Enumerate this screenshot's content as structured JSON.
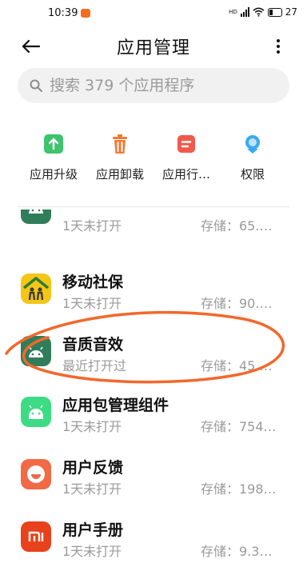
{
  "status_bar": {
    "time": "10:39",
    "network": "HD",
    "battery": "27"
  },
  "header": {
    "title": "应用管理"
  },
  "search": {
    "placeholder": "搜索 379 个应用程序"
  },
  "quick_actions": [
    {
      "label": "应用升级",
      "icon": "upgrade-icon",
      "color": "#3ec46d"
    },
    {
      "label": "应用卸载",
      "icon": "trash-icon",
      "color": "#f07a34"
    },
    {
      "label": "应用行…",
      "icon": "behavior-icon",
      "color": "#f2594b"
    },
    {
      "label": "权限",
      "icon": "permission-icon",
      "color": "#3aa9f0"
    }
  ],
  "apps": [
    {
      "name": "",
      "subtitle": "1天未打开",
      "size": "存储：65.…",
      "icon": "android-icon",
      "color": "#2f7d5b"
    },
    {
      "name": "移动社保",
      "subtitle": "1天未打开",
      "size": "存储：90.…",
      "icon": "family-house-icon",
      "color": "#f5c518"
    },
    {
      "name": "音质音效",
      "subtitle": "最近打开过",
      "size": "存储：45.…",
      "icon": "android-icon",
      "color": "#2f7d5b"
    },
    {
      "name": "应用包管理组件",
      "subtitle": "1天未打开",
      "size": "存储：754…",
      "icon": "android-icon",
      "color": "#3ddc84"
    },
    {
      "name": "用户反馈",
      "subtitle": "1天未打开",
      "size": "存储：198…",
      "icon": "smile-face-icon",
      "color": "#f06a46"
    },
    {
      "name": "用户手册",
      "subtitle": "1天未打开",
      "size": "存储：9.3…",
      "icon": "mi-logo-icon",
      "color": "#e8421c"
    }
  ],
  "annotation": {
    "color": "#f2682c"
  }
}
